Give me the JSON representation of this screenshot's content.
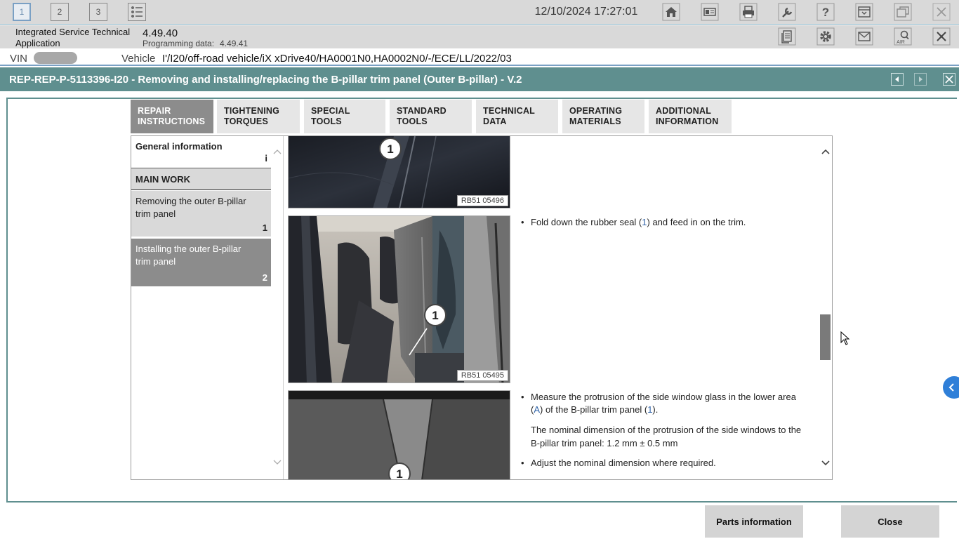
{
  "topbar": {
    "workspaces": [
      "1",
      "2",
      "3"
    ],
    "datetime": "12/10/2024 17:27:01",
    "icons": [
      "list-icon",
      "home-icon",
      "id-card-icon",
      "printer-icon",
      "wrench-icon",
      "help-icon",
      "download-icon",
      "window-restore-icon",
      "close-icon"
    ]
  },
  "app": {
    "name": "Integrated Service Technical Application",
    "version": "4.49.40",
    "programming_label": "Programming data:",
    "programming_value": "4.49.41",
    "icons": [
      "document-icon",
      "settings-gear-icon",
      "mail-icon",
      "air-search-icon",
      "close-icon"
    ]
  },
  "vehicle": {
    "vin_label": "VIN",
    "vehicle_label": "Vehicle",
    "vehicle_value": "I'/I20/off-road vehicle/iX xDrive40/HA0001N0,HA0002N0/-/ECE/LL/2022/03"
  },
  "document": {
    "title": "REP-REP-P-5113396-I20 - Removing and installing/replacing the B-pillar trim panel (Outer B-pillar) - V.2"
  },
  "tabs": [
    {
      "line1": "REPAIR",
      "line2": "INSTRUCTIONS",
      "active": true
    },
    {
      "line1": "TIGHTENING",
      "line2": "TORQUES",
      "active": false
    },
    {
      "line1": "SPECIAL TOOLS",
      "line2": "",
      "active": false
    },
    {
      "line1": "STANDARD",
      "line2": "TOOLS",
      "active": false
    },
    {
      "line1": "TECHNICAL",
      "line2": "DATA",
      "active": false
    },
    {
      "line1": "OPERATING",
      "line2": "MATERIALS",
      "active": false
    },
    {
      "line1": "ADDITIONAL",
      "line2": "INFORMATION",
      "active": false
    }
  ],
  "nav": {
    "general": {
      "label": "General information",
      "num": "i"
    },
    "main_work": "MAIN WORK",
    "items": [
      {
        "label": "Removing the outer B-pillar trim panel",
        "num": "1",
        "selected": false
      },
      {
        "label": "Installing the outer B-pillar trim panel",
        "num": "2",
        "selected": true
      }
    ]
  },
  "content": {
    "images": [
      {
        "ref": "RB51 05496",
        "callout": "1"
      },
      {
        "ref": "RB51 05495",
        "callout": "1"
      },
      {
        "ref": "",
        "callout": "1"
      }
    ],
    "step1": {
      "before": "Fold down the rubber seal (",
      "link": "1",
      "after": ") and feed in on the trim."
    },
    "step2": {
      "line1": "Measure the protrusion of the side window glass in the lower area",
      "line2_before": "(",
      "line2_link_a": "A",
      "line2_mid": ") of the B-pillar trim panel (",
      "line2_link_1": "1",
      "line2_after": ")."
    },
    "nominal_line1": "The nominal dimension of the protrusion of the side windows to the",
    "nominal_line2": "B-pillar trim panel: 1.2 mm ± 0.5 mm",
    "step3": "Adjust the nominal dimension where required."
  },
  "scroll": {
    "position_fraction": 0.55
  },
  "buttons": {
    "parts": "Parts information",
    "close": "Close"
  },
  "colors": {
    "titlebar": "#5f8f8f",
    "active_tab": "#8c8c8c",
    "link": "#2f63a8"
  }
}
